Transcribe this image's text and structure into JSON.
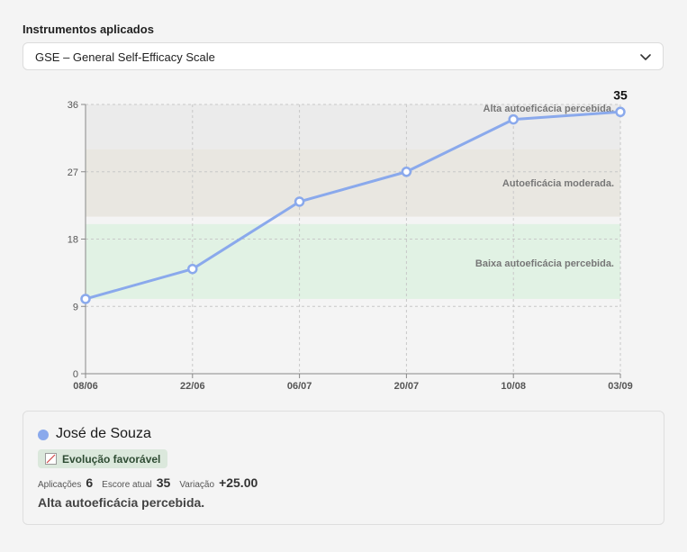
{
  "instruments": {
    "label": "Instrumentos aplicados",
    "selected": "GSE – General Self-Efficacy Scale"
  },
  "colors": {
    "series": "#8aa9ec",
    "band_high": "#ebebeb",
    "band_moderate": "#e9e7e1",
    "band_low": "#e1f2e4"
  },
  "chart_data": {
    "type": "line",
    "x": [
      "08/06",
      "22/06",
      "06/07",
      "20/07",
      "10/08",
      "03/09"
    ],
    "series": [
      {
        "name": "José de Souza",
        "values": [
          10,
          14,
          23,
          27,
          34,
          35
        ]
      }
    ],
    "ylim": [
      0,
      36
    ],
    "yticks": [
      0,
      9,
      18,
      27,
      36
    ],
    "grid": true,
    "last_value_label": "35",
    "bands": [
      {
        "label": "Alta autoeficácia percebida.",
        "from": 30,
        "to": 36
      },
      {
        "label": "Autoeficácia moderada.",
        "from": 21,
        "to": 30
      },
      {
        "label": "Baixa autoeficácia percebida.",
        "from": 10,
        "to": 20
      }
    ]
  },
  "patient": {
    "name": "José de Souza",
    "badge_icon": "trend-up-icon",
    "badge": "Evolução favorável",
    "applications_label": "Aplicações",
    "applications": "6",
    "score_label": "Escore atual",
    "score": "35",
    "variation_label": "Variação",
    "variation": "+25.00",
    "level": "Alta autoeficácia percebida."
  }
}
